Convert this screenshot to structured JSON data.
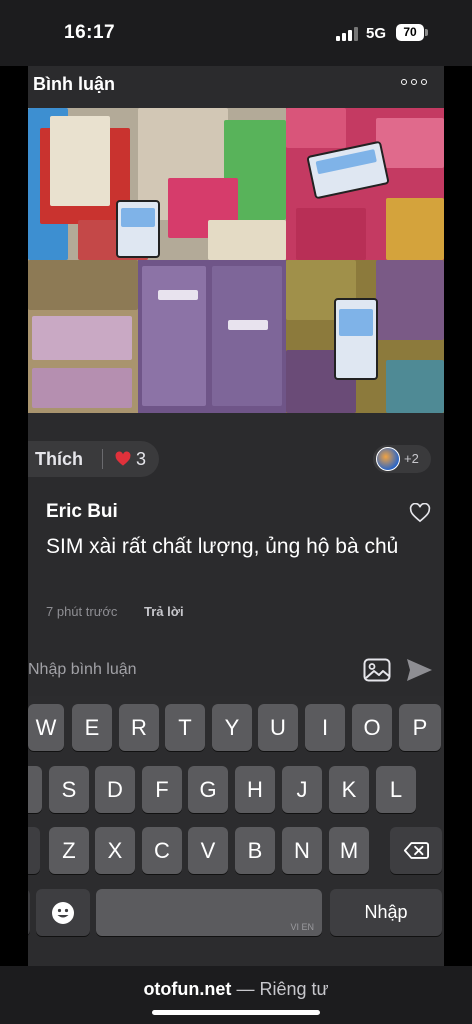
{
  "status_bar": {
    "time": "16:17",
    "network": "5G",
    "battery": "70"
  },
  "sheet": {
    "title": "Bình luận",
    "more_icon": "ellipsis-icon"
  },
  "reactions": {
    "like_label": "Thích",
    "heart_count": "3",
    "extra_reactors": "+2"
  },
  "comment": {
    "author": "Eric Bui",
    "text": "SIM xài rất chất lượng, ủng hộ bà chủ",
    "time": "7 phút trước",
    "reply_label": "Trả lời"
  },
  "input": {
    "placeholder": "Nhập bình luận"
  },
  "keyboard": {
    "row1": [
      "W",
      "E",
      "R",
      "T",
      "Y",
      "U",
      "I",
      "O",
      "P"
    ],
    "row2": [
      "S",
      "D",
      "F",
      "G",
      "H",
      "J",
      "K",
      "L"
    ],
    "row3": [
      "Z",
      "X",
      "C",
      "V",
      "B",
      "N",
      "M"
    ],
    "space_hint": "VI EN",
    "return_label": "Nhập"
  },
  "browser": {
    "domain": "otofun.net",
    "separator": "—",
    "mode": "Riêng tư"
  },
  "colors": {
    "heart": "#e0313b",
    "send": "#8e8e93",
    "sheet_bg": "#2b2b2d"
  }
}
